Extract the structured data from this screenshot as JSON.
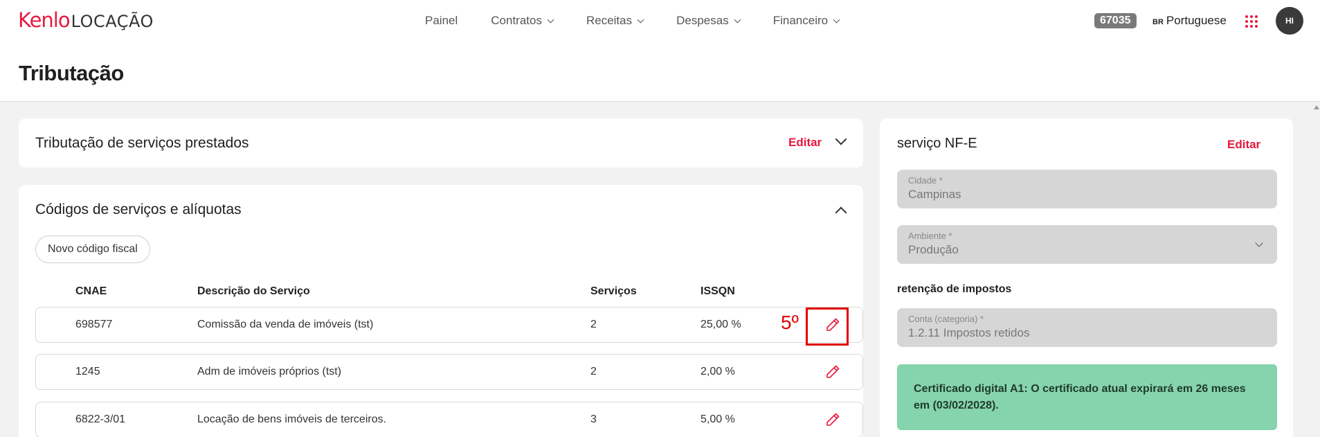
{
  "brand": {
    "name": "Kenlo",
    "product": "LOCAÇÃO"
  },
  "nav": {
    "items": [
      {
        "label": "Painel",
        "dropdown": false
      },
      {
        "label": "Contratos",
        "dropdown": true
      },
      {
        "label": "Receitas",
        "dropdown": true
      },
      {
        "label": "Despesas",
        "dropdown": true
      },
      {
        "label": "Financeiro",
        "dropdown": true
      }
    ]
  },
  "header": {
    "badge": "67035",
    "language_flag": "BR",
    "language": "Portuguese",
    "avatar_initials": "HI"
  },
  "page": {
    "title": "Tributação"
  },
  "tributacao_card": {
    "title": "Tributação de serviços prestados",
    "edit_label": "Editar"
  },
  "codes_card": {
    "title": "Códigos de serviços e alíquotas",
    "new_button": "Novo código fiscal",
    "columns": [
      "CNAE",
      "Descrição do Serviço",
      "Serviços",
      "ISSQN"
    ],
    "rows": [
      {
        "cnae": "698577",
        "descricao": "Comissão da venda de imóveis (tst)",
        "servicos": "2",
        "issqn": "25,00 %"
      },
      {
        "cnae": "1245",
        "descricao": "Adm de imóveis próprios (tst)",
        "servicos": "2",
        "issqn": "2,00 %"
      },
      {
        "cnae": "6822-3/01",
        "descricao": "Locação de bens imóveis de terceiros.",
        "servicos": "3",
        "issqn": "5,00 %"
      }
    ],
    "annotation": "5º"
  },
  "nfe_card": {
    "title": "serviço NF-E",
    "edit_label": "Editar",
    "cidade": {
      "label": "Cidade *",
      "value": "Campinas"
    },
    "ambiente": {
      "label": "Ambiente *",
      "value": "Produção"
    },
    "retencao_title": "retenção de impostos",
    "conta": {
      "label": "Conta (categoria) *",
      "value": "1.2.11 Impostos retidos"
    },
    "alert": "Certificado digital A1: O certificado atual expirará em 26 meses em (03/02/2028)."
  },
  "colors": {
    "accent": "#e8183f",
    "success_bg": "#86d4ad",
    "annotation": "#e00000"
  }
}
